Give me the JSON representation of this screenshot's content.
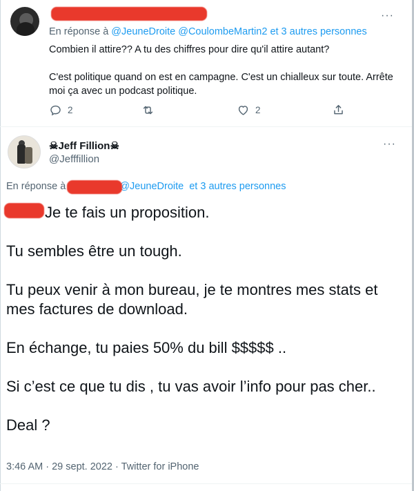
{
  "top_tweet": {
    "reply_prefix": "En réponse à",
    "mention_1": "@JeuneDroite",
    "mention_2": "@CoulombeMartin2",
    "others": "et 3 autres personnes",
    "paragraphs": [
      "Combien il attire?? A tu des chiffres pour dire qu'il attire autant?",
      "C'est politique quand on est en campagne. C'est un chialleux sur toute. Arrête moi ça avec un podcast politique."
    ],
    "reply_count": "2",
    "like_count": "2",
    "more_label": "···"
  },
  "main_tweet": {
    "display_name": "Jeff Fillion",
    "name_emoji": "☠",
    "handle": "@Jefffillion",
    "more_label": "···",
    "reply_prefix": "En réponse à",
    "mention_1": "@JeuneDroite",
    "others": "et 3 autres personnes",
    "paragraphs": [
      "Je te fais un proposition.",
      "Tu sembles être un tough.",
      "Tu peux venir à mon bureau, je te montres mes stats et mes factures de download.",
      "En échange, tu paies 50% du bill $$$$$ ..",
      "Si c’est ce que tu dis , tu vas avoir l’info pour pas cher..",
      "Deal ?"
    ],
    "time": "3:46 AM",
    "date": "29 sept. 2022",
    "source": "Twitter for iPhone",
    "separator": "·"
  },
  "colors": {
    "link": "#1d9bf0",
    "secondary_text": "#536471",
    "redaction": "#e9392c"
  },
  "icons": [
    "reply-icon",
    "retweet-icon",
    "like-icon",
    "share-icon",
    "more-icon"
  ]
}
